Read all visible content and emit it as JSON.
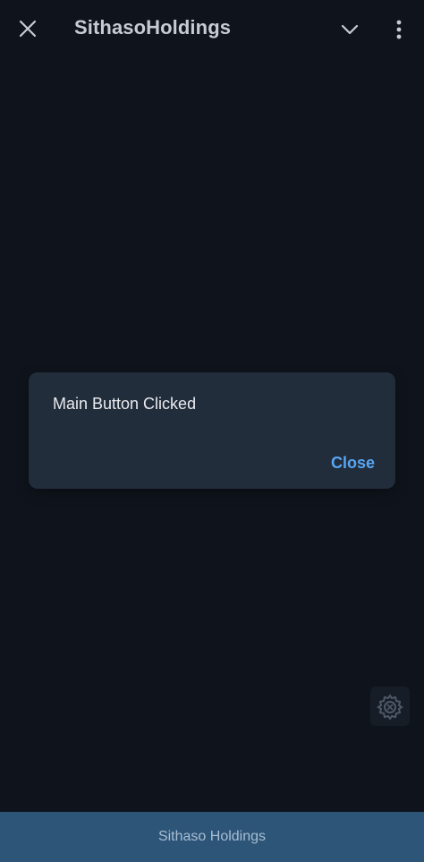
{
  "app": {
    "title": "SithasoHoldings"
  },
  "dialog": {
    "message": "Main Button Clicked",
    "close_label": "Close"
  },
  "footer": {
    "text": "Sithaso Holdings"
  },
  "icons": {
    "close": "close-icon",
    "dropdown": "chevron-down-icon",
    "more": "more-vertical-icon",
    "settings": "settings-gear-icon"
  },
  "colors": {
    "background": "#0f141c",
    "dialog": "#222d3b",
    "accent": "#58a6f2",
    "footer": "#2d5578"
  }
}
